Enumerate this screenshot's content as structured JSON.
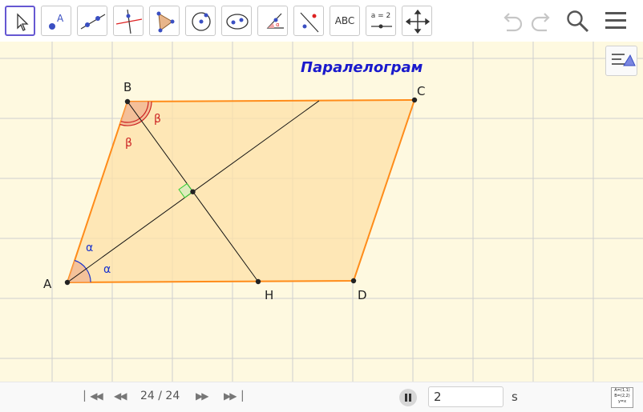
{
  "toolbar": {
    "text_tool_label": "ABC",
    "slider_tool_label": "a = 2"
  },
  "canvas": {
    "title": "Паралелограм",
    "points": {
      "A": "A",
      "B": "B",
      "C": "C",
      "D": "D",
      "H": "H"
    },
    "angles": {
      "alpha": "α",
      "beta": "β"
    }
  },
  "colors": {
    "polygon_stroke": "#ff8c1a",
    "polygon_fill": "#fde0a8",
    "title": "#1a1acc",
    "alpha": "#1a33cc",
    "beta": "#cc2222",
    "right_angle": "#33cc33",
    "active_tool": "#6557d2"
  },
  "animation": {
    "step_counter": "24 / 24",
    "speed_value": "2",
    "speed_unit": "s"
  },
  "algebra_icon": {
    "line1": "A=(1,1)",
    "line2": "B=(2,2)",
    "line3": "y=x"
  },
  "icons": [
    "move-icon",
    "point-icon",
    "line-icon",
    "perpendicular-icon",
    "polygon-icon",
    "circle-icon",
    "conic-icon",
    "angle-icon",
    "reflect-icon",
    "text-icon",
    "slider-icon",
    "move-graphics-icon",
    "undo-icon",
    "redo-icon",
    "search-icon",
    "menu-icon",
    "style-bar-icon",
    "first-icon",
    "previous-icon",
    "next-icon",
    "last-icon",
    "pause-icon",
    "algebra-input-icon"
  ]
}
